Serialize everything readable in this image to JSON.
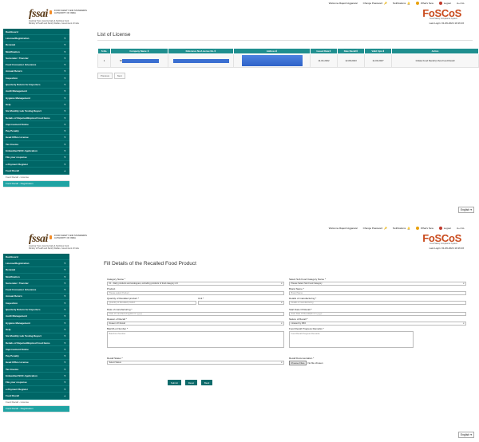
{
  "header": {
    "org_line1": "FOOD SAFETY AND STANDARDS",
    "org_line2": "AUTHORITY OF INDIA",
    "tagline": "Inspiring Trust, Assuring Safe & Nutritious Food",
    "tagline2": "Ministry of Health and Family Welfare, Government of India",
    "logo_text": "fssai",
    "brand": "FoSCoS",
    "brand_sub": "Food Safety Compliance System",
    "last_login": "Last Login: 01-09-2024 10:16:16",
    "welcome": "Welcome Rajesh Aggarwal",
    "change_password": "Change Password",
    "notifications": "Notifications",
    "whats_new": "What's New",
    "logout": "Logout",
    "size_controls": "A+ A A-"
  },
  "sidebar": {
    "items": [
      {
        "label": "Dashboard",
        "chev": ""
      },
      {
        "label": "License/Registration",
        "chev": "▾"
      },
      {
        "label": "Renewal",
        "chev": "▾"
      },
      {
        "label": "Modification",
        "chev": "▾"
      },
      {
        "label": "Surrender / Transfer",
        "chev": "▾"
      },
      {
        "label": "Food Consumer Grievance",
        "chev": "▾"
      },
      {
        "label": "Annual Return",
        "chev": "▾"
      },
      {
        "label": "Inspection",
        "chev": "▾"
      },
      {
        "label": "Quarterly Return for Exporters",
        "chev": "▾"
      },
      {
        "label": "Audit Management",
        "chev": "▾"
      },
      {
        "label": "Hygiene Management",
        "chev": "▾"
      },
      {
        "label": "Help",
        "chev": "▾"
      },
      {
        "label": "Six Monthly Lab Testing Report",
        "chev": "▾"
      },
      {
        "label": "Details of Rejected/Expired Food Items",
        "chev": "▾"
      },
      {
        "label": "Improvement Notice",
        "chev": "▾"
      },
      {
        "label": "Pay Penalty",
        "chev": "▾"
      },
      {
        "label": "Head Office License",
        "chev": "▾"
      },
      {
        "label": "Tax Invoice",
        "chev": "▾"
      },
      {
        "label": "Embedded NOC Application",
        "chev": "▾"
      },
      {
        "label": "File your response",
        "chev": "▾"
      },
      {
        "label": "e-Payment Register",
        "chev": "▾"
      },
      {
        "label": "Food Recall",
        "chev": "▴"
      }
    ],
    "sub_items": [
      "Food Recall - License",
      "Food Recall - Registration"
    ]
  },
  "list_page": {
    "title": "List of License",
    "columns": [
      "S.No.",
      "Company Name ⇕",
      "Reference No./License No.⇕",
      "Address⇕",
      "Issued Date⇕",
      "Date Recall⇕",
      "Valid Upto⇕",
      "Action"
    ],
    "rows": [
      {
        "sno": "1",
        "company": "M/",
        "issued": "11-04-2022",
        "recall": "12-08-2023",
        "valid": "11-09-2027",
        "action": "Initiate Food Recall || View Food Recall"
      }
    ],
    "previous": "Previous",
    "next": "Next"
  },
  "form_page": {
    "title": "Fill Details of the Recalled Food Product",
    "fields": {
      "category_label": "Category Name *",
      "category_value": "01 - Dairy products and analogues, excluding products of food category 2.0",
      "subcategory_label": "Select Sub Food Category Name *",
      "subcategory_value": "Please Select Sub Food Category",
      "product_label": "Product",
      "product_value": "Please select Product",
      "brand_label": "Brand Name *",
      "brand_placeholder": "Brand Name",
      "quantity_label": "Quantity of Recalled product *",
      "quantity_placeholder": "Quantity of Recalled product",
      "unit_label": "Unit *",
      "details_label": "Details of manufacturing *",
      "details_placeholder": "Details of manufacturing",
      "date_label": "Date of manufacturing *",
      "date_placeholder": "Date of manufacturing(dd-mm-yyyy)",
      "start_label": "Start Date Of Recall *",
      "start_placeholder": "Start Date Of Recall(dd-mm-yyyy)",
      "reason_label": "Reason of Recall *",
      "reason_value": "Reason Of Recall",
      "initiated_label": "Nature of Recall *",
      "initiated_value": "Initiated by FBO",
      "batch_label": "Batch/Lot Number *",
      "batch_placeholder": "Batch/Lot Number",
      "progress_label": "Food Recall Progress Remarks *",
      "progress_placeholder": "Food Recall Progress Remarks",
      "status_label": "Recall Status *",
      "status_value": "Select Status",
      "doc_label": "Recall Documentation *",
      "choose_file": "Choose Files",
      "no_file": "No file chosen"
    },
    "buttons": {
      "submit": "Submit",
      "reset": "Reset",
      "back": "Back"
    }
  },
  "language": "English",
  "colors": {
    "sidebar": "#006666",
    "table_header": "#1f8f8f",
    "brand": "#c94a1c",
    "redaction": "#3b6fd1"
  }
}
